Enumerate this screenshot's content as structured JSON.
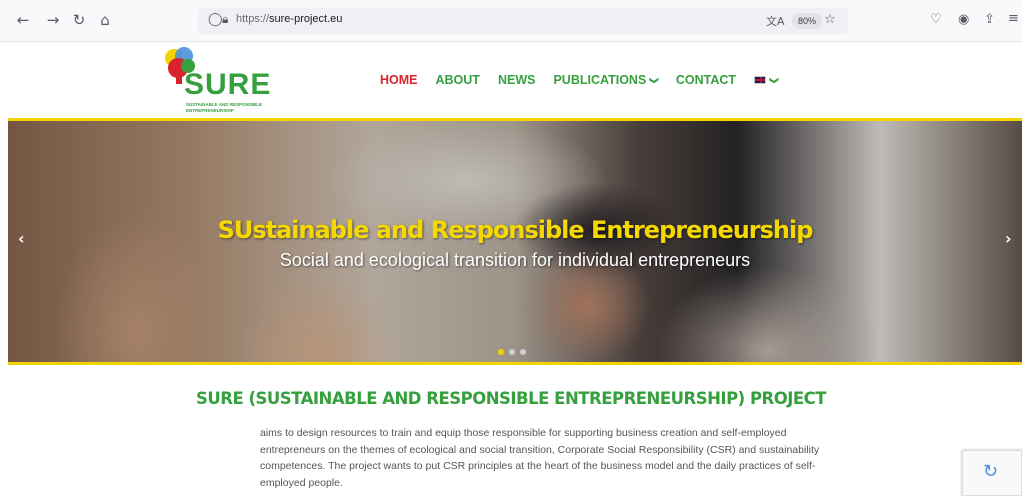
{
  "browser": {
    "url_prefix": "https://",
    "url_host": "sure-project.eu",
    "zoom": "80%",
    "icons": [
      "back-arrow-icon",
      "forward-arrow-icon",
      "reload-icon",
      "home-icon",
      "shield-icon",
      "lock-icon",
      "translate-icon",
      "bookmark-star-icon",
      "pocket-icon",
      "account-icon",
      "extensions-icon",
      "menu-icon"
    ]
  },
  "site": {
    "logo_text": "SURE",
    "logo_tagline": "Sustainable and Responsible Entrepreneurship",
    "nav": [
      {
        "label": "HOME",
        "active": true
      },
      {
        "label": "ABOUT",
        "active": false
      },
      {
        "label": "NEWS",
        "active": false
      },
      {
        "label": "PUBLICATIONS",
        "active": false,
        "dropdown": true
      },
      {
        "label": "CONTACT",
        "active": false
      }
    ],
    "colors": {
      "brand_green": "#36a03e",
      "active_red": "#d9232e",
      "accent_yellow": "#f3d400"
    }
  },
  "hero": {
    "title": "SUstainable and Responsible Entrepreneurship",
    "subtitle": "Social and ecological transition for individual entrepreneurs",
    "prev_arrow": "‹",
    "next_arrow": "›",
    "slides_count": 3,
    "active_slide": 1
  },
  "content": {
    "heading": "SURE (SUSTAINABLE AND RESPONSIBLE ENTREPRENEURSHIP) PROJECT",
    "paragraph": "aims to design resources to train and equip those responsible for supporting business creation and self-employed entrepreneurs on the themes of ecological and social transition, Corporate Social Responsibility (CSR) and sustainability competences. The project wants to put CSR principles at the heart of the business model and the daily practices of self-employed people."
  }
}
